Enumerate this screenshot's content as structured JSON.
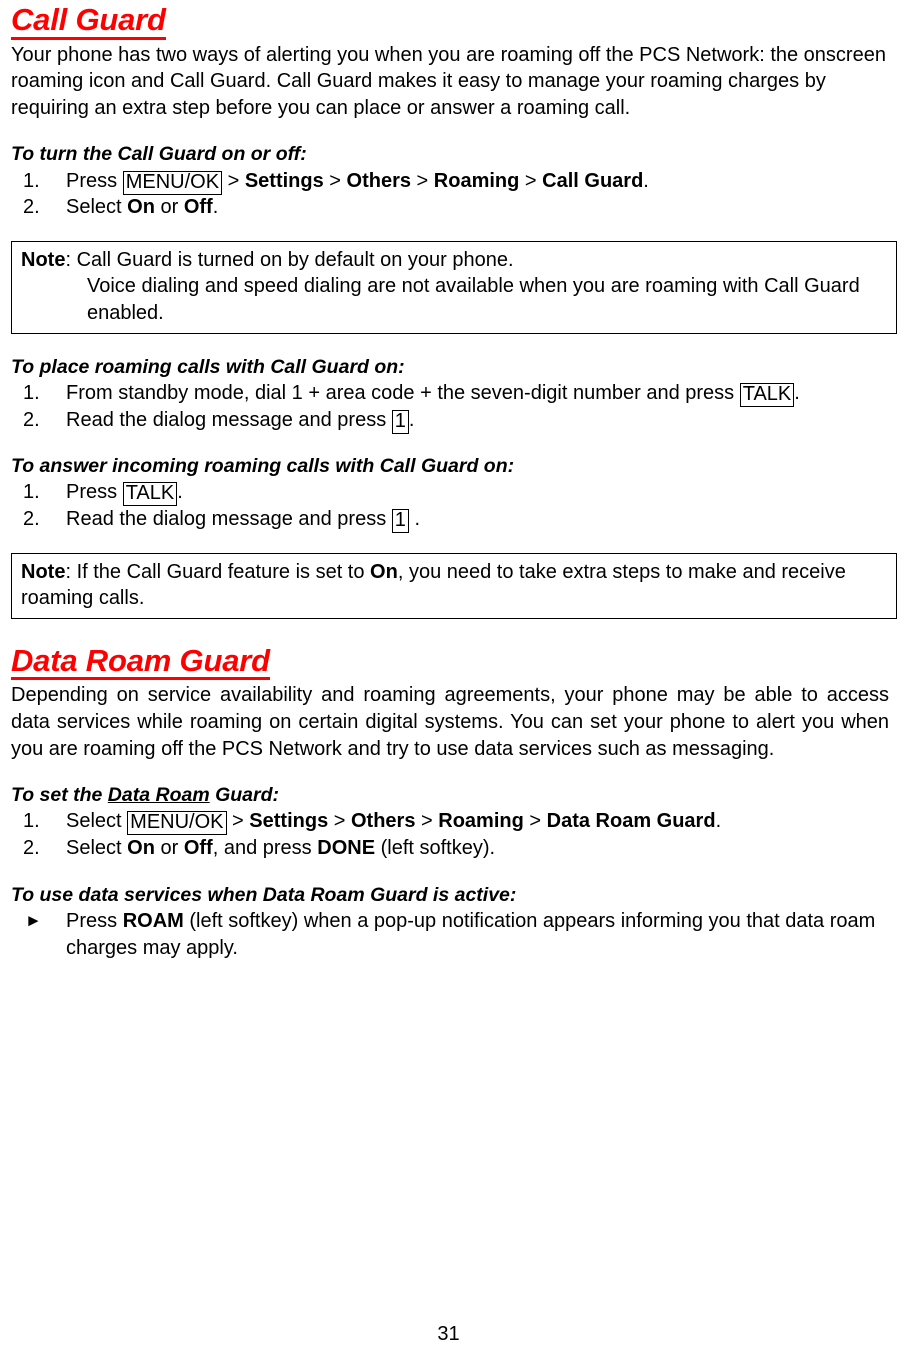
{
  "document": {
    "page_number": "31",
    "accent_color": "#ff0000"
  },
  "sections": [
    {
      "title": "Call Guard",
      "intro": "Your phone has two ways of alerting you when you are roaming off the PCS Network: the onscreen roaming icon and Call Guard. Call Guard makes it easy to manage your roaming charges by requiring an extra step before you can place or answer a roaming call.",
      "proc1": {
        "heading": "To turn the Call Guard on or off:",
        "step1": {
          "num": "1.",
          "pre": "Press ",
          "key": "MENU/OK",
          "sep1": " > ",
          "b1": "Settings",
          "sep2": " > ",
          "b2": "Others",
          "sep3": " > ",
          "b3": "Roaming",
          "sep4": " > ",
          "b4": "Call Guard",
          "end": "."
        },
        "step2": {
          "num": "2.",
          "pre": "Select ",
          "b1": "On",
          "mid": " or ",
          "b2": "Off",
          "end": "."
        }
      },
      "note1": {
        "label": "Note",
        "line1": ": Call Guard is turned on by default on your phone.",
        "line2": "Voice dialing and speed dialing are not available when you are roaming with Call Guard enabled."
      },
      "proc2": {
        "heading": "To place roaming calls with Call Guard on:",
        "step1": {
          "num": "1.",
          "pre": "From standby mode, dial 1 + area code + the seven-digit number and press ",
          "key": "TALK",
          "end": "."
        },
        "step2": {
          "num": "2.",
          "pre": "Read the dialog message and press ",
          "key": "1",
          "end": "."
        }
      },
      "proc3": {
        "heading": "To answer incoming roaming calls with Call Guard on:",
        "step1": {
          "num": "1.",
          "pre": "Press ",
          "key": "TALK",
          "end": "."
        },
        "step2": {
          "num": "2.",
          "pre": "Read the dialog message and press ",
          "key": "1",
          "end": " ."
        }
      },
      "note2": {
        "label": "Note",
        "pre": ": If the Call Guard feature is set to ",
        "bold": "On",
        "post": ", you need to take extra steps to make and receive roaming calls."
      }
    },
    {
      "title": "Data Roam Guard",
      "intro": "Depending on service availability and roaming agreements, your phone may be able to access data services while roaming on certain digital systems. You can set your phone to alert you when you are roaming off the PCS Network and try to use data services such as messaging.",
      "proc1": {
        "heading_pre": "To set the ",
        "heading_underlined": "Data Roam",
        "heading_post": " Guard:",
        "step1": {
          "num": "1.",
          "pre": "Select ",
          "key": "MENU/OK",
          "sep1": " > ",
          "b1": "Settings",
          "sep2": " > ",
          "b2": "Others",
          "sep3": " > ",
          "b3": "Roaming",
          "sep4": " > ",
          "b4": "Data Roam Guard",
          "end": "."
        },
        "step2": {
          "num": "2.",
          "pre": "Select ",
          "b1": "On",
          "mid": " or ",
          "b2": "Off",
          "mid2": ", and press ",
          "b3": "DONE",
          "end": " (left softkey)."
        }
      },
      "proc2": {
        "heading": "To use data services when Data Roam Guard is active:",
        "bullet": {
          "marker": "►",
          "pre": "Press ",
          "bold": "ROAM",
          "post": " (left softkey) when a pop-up notification appears informing you that data roam charges may apply."
        }
      }
    }
  ]
}
